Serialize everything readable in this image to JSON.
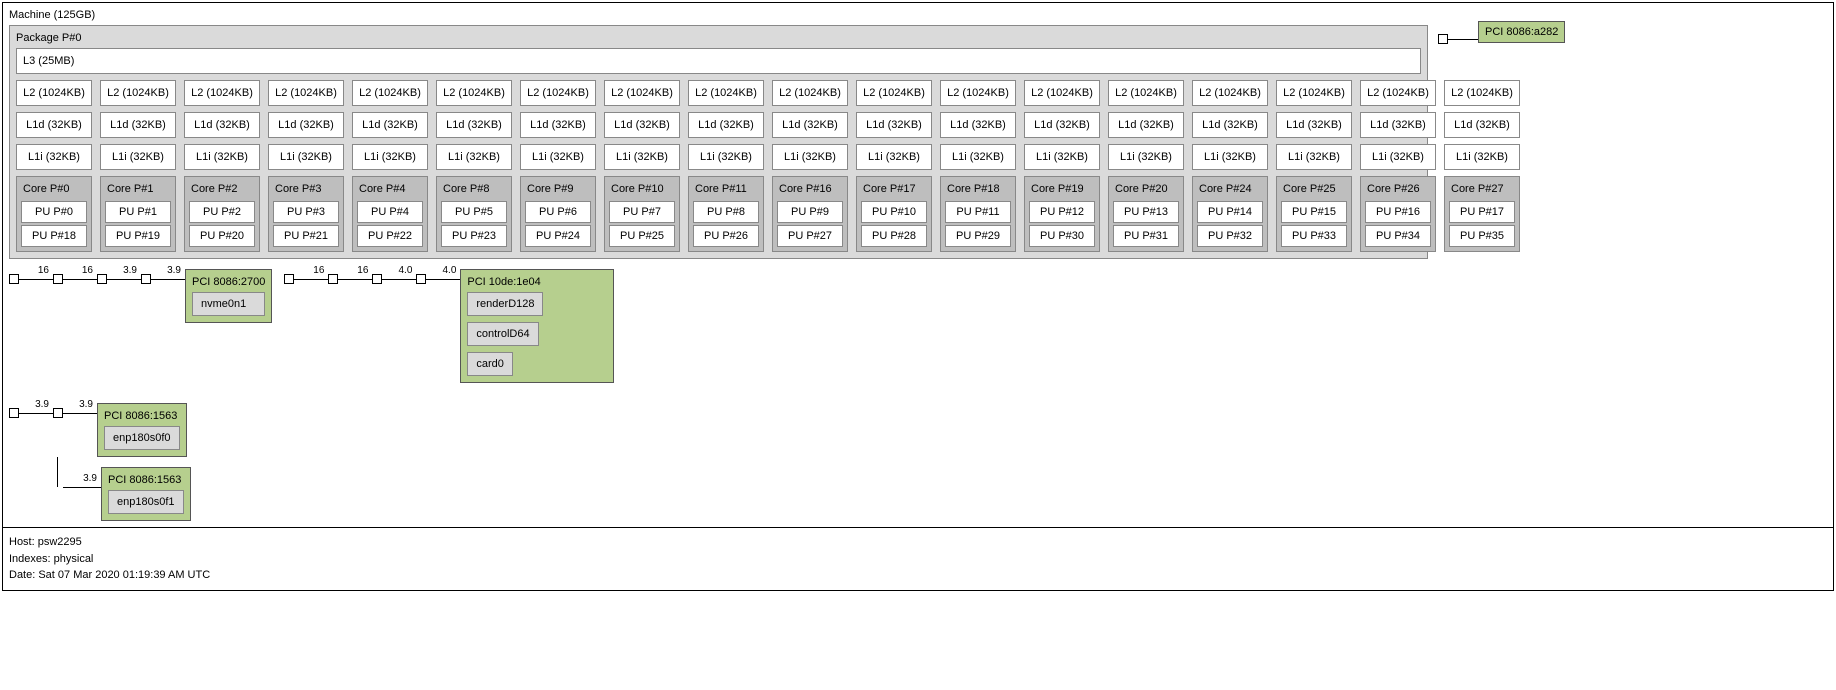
{
  "machine_label": "Machine (125GB)",
  "package_label": "Package P#0",
  "l3_label": "L3 (25MB)",
  "l2_label": "L2 (1024KB)",
  "l1d_label": "L1d (32KB)",
  "l1i_label": "L1i (32KB)",
  "cores": [
    {
      "core": "Core P#0",
      "pu": [
        "PU P#0",
        "PU P#18"
      ]
    },
    {
      "core": "Core P#1",
      "pu": [
        "PU P#1",
        "PU P#19"
      ]
    },
    {
      "core": "Core P#2",
      "pu": [
        "PU P#2",
        "PU P#20"
      ]
    },
    {
      "core": "Core P#3",
      "pu": [
        "PU P#3",
        "PU P#21"
      ]
    },
    {
      "core": "Core P#4",
      "pu": [
        "PU P#4",
        "PU P#22"
      ]
    },
    {
      "core": "Core P#8",
      "pu": [
        "PU P#5",
        "PU P#23"
      ]
    },
    {
      "core": "Core P#9",
      "pu": [
        "PU P#6",
        "PU P#24"
      ]
    },
    {
      "core": "Core P#10",
      "pu": [
        "PU P#7",
        "PU P#25"
      ]
    },
    {
      "core": "Core P#11",
      "pu": [
        "PU P#8",
        "PU P#26"
      ]
    },
    {
      "core": "Core P#16",
      "pu": [
        "PU P#9",
        "PU P#27"
      ]
    },
    {
      "core": "Core P#17",
      "pu": [
        "PU P#10",
        "PU P#28"
      ]
    },
    {
      "core": "Core P#18",
      "pu": [
        "PU P#11",
        "PU P#29"
      ]
    },
    {
      "core": "Core P#19",
      "pu": [
        "PU P#12",
        "PU P#30"
      ]
    },
    {
      "core": "Core P#20",
      "pu": [
        "PU P#13",
        "PU P#31"
      ]
    },
    {
      "core": "Core P#24",
      "pu": [
        "PU P#14",
        "PU P#32"
      ]
    },
    {
      "core": "Core P#25",
      "pu": [
        "PU P#15",
        "PU P#33"
      ]
    },
    {
      "core": "Core P#26",
      "pu": [
        "PU P#16",
        "PU P#34"
      ]
    },
    {
      "core": "Core P#27",
      "pu": [
        "PU P#17",
        "PU P#35"
      ]
    }
  ],
  "bus": {
    "nvme": {
      "links": [
        "16",
        "16",
        "3.9",
        "3.9"
      ],
      "pci": "PCI 8086:2700",
      "dev": "nvme0n1"
    },
    "gpu": {
      "links": [
        "16",
        "16",
        "4.0",
        "4.0"
      ],
      "pci": "PCI 10de:1e04",
      "devs": [
        "renderD128",
        "controlD64",
        "card0"
      ]
    },
    "net0": {
      "links": [
        "3.9",
        "3.9"
      ],
      "pci": "PCI 8086:1563",
      "dev": "enp180s0f0"
    },
    "net1": {
      "link": "3.9",
      "pci": "PCI 8086:1563",
      "dev": "enp180s0f1"
    },
    "side": {
      "pci": "PCI 8086:a282"
    }
  },
  "footer": {
    "host": "Host: psw2295",
    "indexes": "Indexes: physical",
    "date": "Date: Sat 07 Mar 2020 01:19:39 AM UTC"
  }
}
